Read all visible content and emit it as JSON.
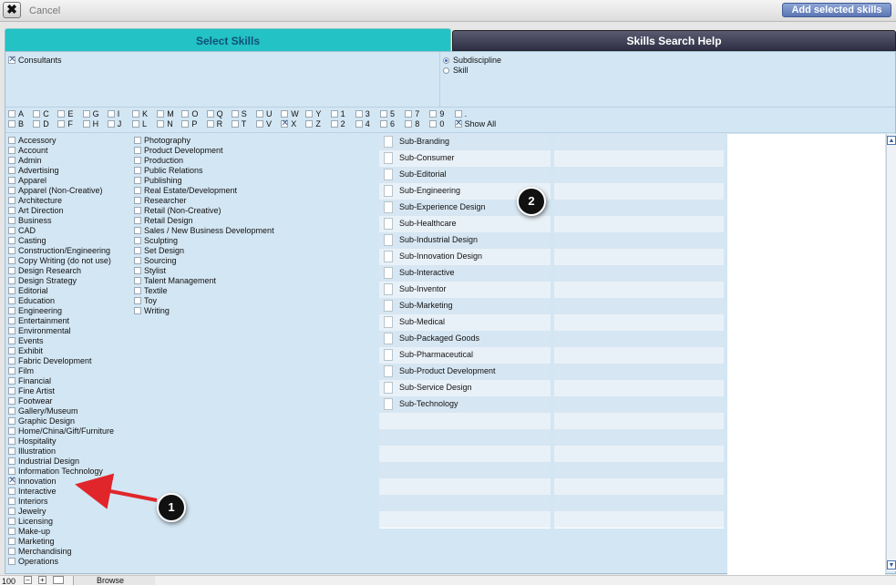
{
  "toolbar": {
    "cancel_label": "Cancel",
    "add_label": "Add selected skills"
  },
  "tabs": {
    "select": "Select Skills",
    "help": "Skills Search Help"
  },
  "filters": {
    "consultants": {
      "label": "Consultants",
      "checked": true
    },
    "mode_options": [
      {
        "label": "Subdiscipline",
        "selected": true
      },
      {
        "label": "Skill",
        "selected": false
      }
    ]
  },
  "letters": {
    "row1": [
      "A",
      "C",
      "E",
      "G",
      "I",
      "K",
      "M",
      "O",
      "Q",
      "S",
      "U",
      "W",
      "Y",
      "1",
      "3",
      "5",
      "7",
      "9",
      "."
    ],
    "row2": [
      "B",
      "D",
      "F",
      "H",
      "J",
      "L",
      "N",
      "P",
      "R",
      "T",
      "V",
      "X",
      "Z",
      "2",
      "4",
      "6",
      "8",
      "0"
    ],
    "row2_checked": [
      "X"
    ],
    "show_all": "Show All"
  },
  "disciplines_col1": [
    "Accessory",
    "Account",
    "Admin",
    "Advertising",
    "Apparel",
    "Apparel (Non-Creative)",
    "Architecture",
    "Art Direction",
    "Business",
    "CAD",
    "Casting",
    "Construction/Engineering",
    "Copy Writing (do not use)",
    "Design Research",
    "Design Strategy",
    "Editorial",
    "Education",
    "Engineering",
    "Entertainment",
    "Environmental",
    "Events",
    "Exhibit",
    "Fabric Development",
    "Film",
    "Financial",
    "Fine Artist",
    "Footwear",
    "Gallery/Museum",
    "Graphic Design",
    "Home/China/Gift/Furniture",
    "Hospitality",
    "Illustration",
    "Industrial Design",
    "Information Technology",
    "Innovation",
    "Interactive",
    "Interiors",
    "Jewelry",
    "Licensing",
    "Make-up",
    "Marketing",
    "Merchandising",
    "Operations"
  ],
  "disciplines_col1_checked": [
    "Innovation"
  ],
  "disciplines_col2": [
    "Photography",
    "Product Development",
    "Production",
    "Public Relations",
    "Publishing",
    "Real Estate/Development",
    "Researcher",
    "Retail  (Non-Creative)",
    "Retail Design",
    "Sales / New Business Development",
    "Sculpting",
    "Set Design",
    "Sourcing",
    "Stylist",
    "Talent Management",
    "Textile",
    "Toy",
    "Writing"
  ],
  "subdisciplines": [
    "Sub-Branding",
    "Sub-Consumer",
    "Sub-Editorial",
    "Sub-Engineering",
    "Sub-Experience Design",
    "Sub-Healthcare",
    "Sub-Industrial Design",
    "Sub-Innovation Design",
    "Sub-Interactive",
    "Sub-Inventor",
    "Sub-Marketing",
    "Sub-Medical",
    "Sub-Packaged Goods",
    "Sub-Pharmaceutical",
    "Sub-Product Development",
    "Sub-Service Design",
    "Sub-Technology"
  ],
  "annotations": {
    "one": "1",
    "two": "2"
  },
  "status": {
    "zoom": "100",
    "mode": "Browse"
  },
  "colors": {
    "accent": "#23c2c4",
    "panel": "#d3e6f3",
    "arrow": "#e0262b"
  },
  "icons": {
    "cancel": "close-x-icon",
    "scroll_up": "arrow-up-icon",
    "scroll_down": "arrow-down-icon"
  }
}
